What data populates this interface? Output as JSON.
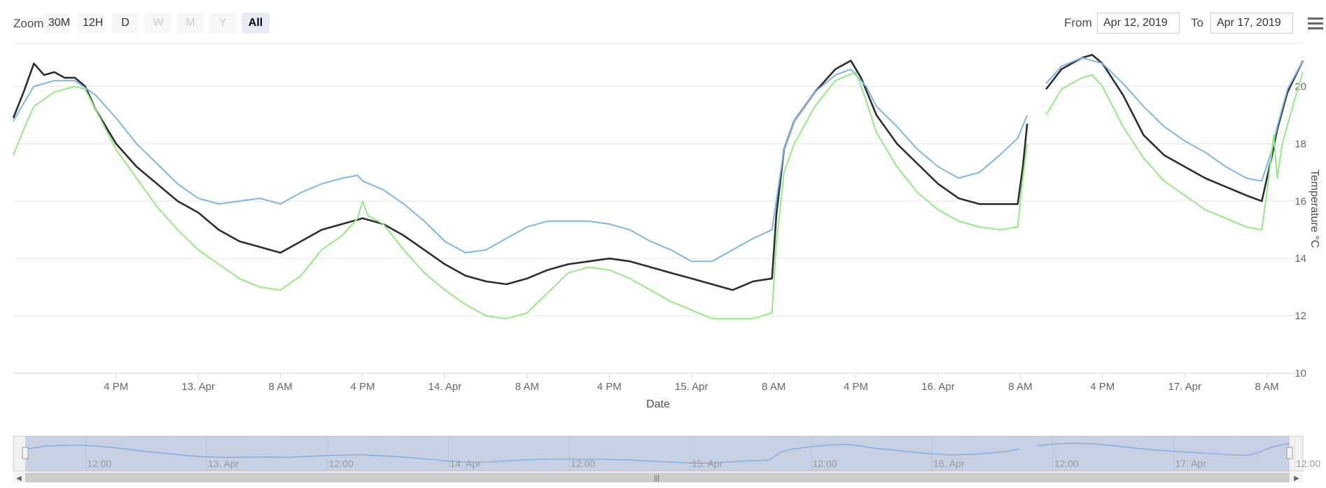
{
  "toolbar": {
    "zoom_label": "Zoom",
    "buttons": [
      "30M",
      "12H",
      "D",
      "W",
      "M",
      "Y",
      "All"
    ],
    "disabled_buttons": [
      "W",
      "M",
      "Y"
    ],
    "active_button": "All",
    "from_label": "From",
    "from_value": "Apr 12, 2019",
    "to_label": "To",
    "to_value": "Apr 17, 2019"
  },
  "colors": {
    "series_dark": "#2b2d33",
    "series_blue": "#7cb5ec",
    "series_green": "#90ed7d",
    "grid": "#e6e6e6",
    "navigator_mask": "rgba(102,133,194,0.3)"
  },
  "chart_data": {
    "type": "line",
    "xlabel": "Date",
    "ylabel": "Temperature °C",
    "x_range": [
      "2019-04-12T06:00",
      "2019-04-17T11:30"
    ],
    "ylim": [
      10,
      21.5
    ],
    "yticks": [
      10,
      12,
      14,
      16,
      18,
      20
    ],
    "xtick_labels": [
      "4 PM",
      "13. Apr",
      "8 AM",
      "4 PM",
      "14. Apr",
      "8 AM",
      "4 PM",
      "15. Apr",
      "8 AM",
      "4 PM",
      "16. Apr",
      "8 AM",
      "4 PM",
      "17. Apr",
      "8 AM"
    ],
    "xtick_times": [
      "2019-04-12T16:00",
      "2019-04-13T00:00",
      "2019-04-13T08:00",
      "2019-04-13T16:00",
      "2019-04-14T00:00",
      "2019-04-14T08:00",
      "2019-04-14T16:00",
      "2019-04-15T00:00",
      "2019-04-15T08:00",
      "2019-04-15T16:00",
      "2019-04-16T00:00",
      "2019-04-16T08:00",
      "2019-04-16T16:00",
      "2019-04-17T00:00",
      "2019-04-17T08:00"
    ],
    "navigator_labels": [
      "12:00",
      "13. Apr",
      "12:00",
      "14. Apr",
      "12:00",
      "15. Apr",
      "12:00",
      "16. Apr",
      "12:00",
      "17. Apr",
      "12:00"
    ],
    "navigator_times": [
      "2019-04-12T12:00",
      "2019-04-13T00:00",
      "2019-04-13T12:00",
      "2019-04-14T00:00",
      "2019-04-14T12:00",
      "2019-04-15T00:00",
      "2019-04-15T12:00",
      "2019-04-16T00:00",
      "2019-04-16T12:00",
      "2019-04-17T00:00",
      "2019-04-17T12:00"
    ],
    "grid": true,
    "series": [
      {
        "color": "#2b2d33",
        "points": [
          [
            "2019-04-12T06:00",
            18.9
          ],
          [
            "2019-04-12T07:00",
            19.8
          ],
          [
            "2019-04-12T08:00",
            20.8
          ],
          [
            "2019-04-12T09:00",
            20.4
          ],
          [
            "2019-04-12T10:00",
            20.5
          ],
          [
            "2019-04-12T11:00",
            20.3
          ],
          [
            "2019-04-12T12:00",
            20.3
          ],
          [
            "2019-04-12T13:00",
            20.0
          ],
          [
            "2019-04-12T14:00",
            19.2
          ],
          [
            "2019-04-12T16:00",
            18.0
          ],
          [
            "2019-04-12T18:00",
            17.2
          ],
          [
            "2019-04-12T20:00",
            16.6
          ],
          [
            "2019-04-12T22:00",
            16.0
          ],
          [
            "2019-04-13T00:00",
            15.6
          ],
          [
            "2019-04-13T02:00",
            15.0
          ],
          [
            "2019-04-13T04:00",
            14.6
          ],
          [
            "2019-04-13T06:00",
            14.4
          ],
          [
            "2019-04-13T08:00",
            14.2
          ],
          [
            "2019-04-13T10:00",
            14.6
          ],
          [
            "2019-04-13T12:00",
            15.0
          ],
          [
            "2019-04-13T14:00",
            15.2
          ],
          [
            "2019-04-13T16:00",
            15.4
          ],
          [
            "2019-04-13T18:00",
            15.2
          ],
          [
            "2019-04-13T20:00",
            14.8
          ],
          [
            "2019-04-13T22:00",
            14.3
          ],
          [
            "2019-04-14T00:00",
            13.8
          ],
          [
            "2019-04-14T02:00",
            13.4
          ],
          [
            "2019-04-14T04:00",
            13.2
          ],
          [
            "2019-04-14T06:00",
            13.1
          ],
          [
            "2019-04-14T08:00",
            13.3
          ],
          [
            "2019-04-14T10:00",
            13.6
          ],
          [
            "2019-04-14T12:00",
            13.8
          ],
          [
            "2019-04-14T14:00",
            13.9
          ],
          [
            "2019-04-14T16:00",
            14.0
          ],
          [
            "2019-04-14T18:00",
            13.9
          ],
          [
            "2019-04-14T20:00",
            13.7
          ],
          [
            "2019-04-14T22:00",
            13.5
          ],
          [
            "2019-04-15T00:00",
            13.3
          ],
          [
            "2019-04-15T02:00",
            13.1
          ],
          [
            "2019-04-15T04:00",
            12.9
          ],
          [
            "2019-04-15T06:00",
            13.2
          ],
          [
            "2019-04-15T07:50",
            13.3
          ],
          [
            "2019-04-15T08:15",
            15.5
          ],
          [
            "2019-04-15T09:00",
            17.8
          ],
          [
            "2019-04-15T10:00",
            18.8
          ],
          [
            "2019-04-15T12:00",
            19.8
          ],
          [
            "2019-04-15T14:00",
            20.6
          ],
          [
            "2019-04-15T15:30",
            20.9
          ],
          [
            "2019-04-15T16:30",
            20.3
          ],
          [
            "2019-04-15T18:00",
            19.0
          ],
          [
            "2019-04-15T20:00",
            18.0
          ],
          [
            "2019-04-15T22:00",
            17.3
          ],
          [
            "2019-04-16T00:00",
            16.6
          ],
          [
            "2019-04-16T02:00",
            16.1
          ],
          [
            "2019-04-16T04:00",
            15.9
          ],
          [
            "2019-04-16T06:00",
            15.9
          ],
          [
            "2019-04-16T07:45",
            15.9
          ],
          [
            "2019-04-16T08:15",
            17.2
          ],
          [
            "2019-04-16T08:40",
            18.7
          ],
          [
            "2019-04-16T09:30",
            null
          ],
          [
            "2019-04-16T10:30",
            19.9
          ],
          [
            "2019-04-16T12:00",
            20.6
          ],
          [
            "2019-04-16T14:00",
            21.0
          ],
          [
            "2019-04-16T15:00",
            21.1
          ],
          [
            "2019-04-16T16:00",
            20.8
          ],
          [
            "2019-04-16T18:00",
            19.7
          ],
          [
            "2019-04-16T20:00",
            18.3
          ],
          [
            "2019-04-16T22:00",
            17.6
          ],
          [
            "2019-04-17T00:00",
            17.2
          ],
          [
            "2019-04-17T02:00",
            16.8
          ],
          [
            "2019-04-17T04:00",
            16.5
          ],
          [
            "2019-04-17T06:00",
            16.2
          ],
          [
            "2019-04-17T07:30",
            16.0
          ],
          [
            "2019-04-17T08:30",
            17.6
          ],
          [
            "2019-04-17T09:00",
            18.5
          ],
          [
            "2019-04-17T10:00",
            19.8
          ],
          [
            "2019-04-17T11:30",
            20.9
          ]
        ]
      },
      {
        "color": "#7cb5ec",
        "points": [
          [
            "2019-04-12T06:00",
            18.8
          ],
          [
            "2019-04-12T08:00",
            20.0
          ],
          [
            "2019-04-12T10:00",
            20.2
          ],
          [
            "2019-04-12T12:00",
            20.2
          ],
          [
            "2019-04-12T14:00",
            19.7
          ],
          [
            "2019-04-12T16:00",
            18.9
          ],
          [
            "2019-04-12T18:00",
            18.0
          ],
          [
            "2019-04-12T20:00",
            17.3
          ],
          [
            "2019-04-12T22:00",
            16.6
          ],
          [
            "2019-04-13T00:00",
            16.1
          ],
          [
            "2019-04-13T02:00",
            15.9
          ],
          [
            "2019-04-13T04:00",
            16.0
          ],
          [
            "2019-04-13T06:00",
            16.1
          ],
          [
            "2019-04-13T08:00",
            15.9
          ],
          [
            "2019-04-13T10:00",
            16.3
          ],
          [
            "2019-04-13T12:00",
            16.6
          ],
          [
            "2019-04-13T14:00",
            16.8
          ],
          [
            "2019-04-13T15:30",
            16.9
          ],
          [
            "2019-04-13T16:00",
            16.7
          ],
          [
            "2019-04-13T18:00",
            16.4
          ],
          [
            "2019-04-13T20:00",
            15.9
          ],
          [
            "2019-04-13T22:00",
            15.3
          ],
          [
            "2019-04-14T00:00",
            14.6
          ],
          [
            "2019-04-14T02:00",
            14.2
          ],
          [
            "2019-04-14T04:00",
            14.3
          ],
          [
            "2019-04-14T06:00",
            14.7
          ],
          [
            "2019-04-14T08:00",
            15.1
          ],
          [
            "2019-04-14T10:00",
            15.3
          ],
          [
            "2019-04-14T12:00",
            15.3
          ],
          [
            "2019-04-14T14:00",
            15.3
          ],
          [
            "2019-04-14T16:00",
            15.2
          ],
          [
            "2019-04-14T18:00",
            15.0
          ],
          [
            "2019-04-14T20:00",
            14.6
          ],
          [
            "2019-04-14T22:00",
            14.3
          ],
          [
            "2019-04-15T00:00",
            13.9
          ],
          [
            "2019-04-15T02:00",
            13.9
          ],
          [
            "2019-04-15T04:00",
            14.3
          ],
          [
            "2019-04-15T06:00",
            14.7
          ],
          [
            "2019-04-15T07:50",
            15.0
          ],
          [
            "2019-04-15T08:15",
            16.0
          ],
          [
            "2019-04-15T09:00",
            17.8
          ],
          [
            "2019-04-15T10:00",
            18.8
          ],
          [
            "2019-04-15T12:00",
            19.8
          ],
          [
            "2019-04-15T14:00",
            20.4
          ],
          [
            "2019-04-15T15:30",
            20.6
          ],
          [
            "2019-04-15T17:00",
            20.0
          ],
          [
            "2019-04-15T18:00",
            19.3
          ],
          [
            "2019-04-15T20:00",
            18.6
          ],
          [
            "2019-04-15T22:00",
            17.8
          ],
          [
            "2019-04-16T00:00",
            17.2
          ],
          [
            "2019-04-16T02:00",
            16.8
          ],
          [
            "2019-04-16T04:00",
            17.0
          ],
          [
            "2019-04-16T06:00",
            17.6
          ],
          [
            "2019-04-16T07:45",
            18.2
          ],
          [
            "2019-04-16T08:40",
            19.0
          ],
          [
            "2019-04-16T09:30",
            null
          ],
          [
            "2019-04-16T10:30",
            20.1
          ],
          [
            "2019-04-16T12:00",
            20.7
          ],
          [
            "2019-04-16T14:00",
            21.0
          ],
          [
            "2019-04-16T16:00",
            20.8
          ],
          [
            "2019-04-16T18:00",
            20.1
          ],
          [
            "2019-04-16T20:00",
            19.3
          ],
          [
            "2019-04-16T22:00",
            18.6
          ],
          [
            "2019-04-17T00:00",
            18.1
          ],
          [
            "2019-04-17T02:00",
            17.7
          ],
          [
            "2019-04-17T04:00",
            17.2
          ],
          [
            "2019-04-17T06:00",
            16.8
          ],
          [
            "2019-04-17T07:30",
            16.7
          ],
          [
            "2019-04-17T08:30",
            17.8
          ],
          [
            "2019-04-17T09:00",
            18.6
          ],
          [
            "2019-04-17T10:00",
            19.9
          ],
          [
            "2019-04-17T11:30",
            20.9
          ]
        ]
      },
      {
        "color": "#90ed7d",
        "points": [
          [
            "2019-04-12T06:00",
            17.6
          ],
          [
            "2019-04-12T07:00",
            18.5
          ],
          [
            "2019-04-12T08:00",
            19.3
          ],
          [
            "2019-04-12T10:00",
            19.8
          ],
          [
            "2019-04-12T12:00",
            20.0
          ],
          [
            "2019-04-12T13:00",
            19.9
          ],
          [
            "2019-04-12T14:00",
            19.2
          ],
          [
            "2019-04-12T16:00",
            17.8
          ],
          [
            "2019-04-12T18:00",
            16.8
          ],
          [
            "2019-04-12T20:00",
            15.8
          ],
          [
            "2019-04-12T22:00",
            15.0
          ],
          [
            "2019-04-13T00:00",
            14.3
          ],
          [
            "2019-04-13T02:00",
            13.8
          ],
          [
            "2019-04-13T04:00",
            13.3
          ],
          [
            "2019-04-13T06:00",
            13.0
          ],
          [
            "2019-04-13T08:00",
            12.9
          ],
          [
            "2019-04-13T10:00",
            13.4
          ],
          [
            "2019-04-13T12:00",
            14.3
          ],
          [
            "2019-04-13T14:00",
            14.8
          ],
          [
            "2019-04-13T15:30",
            15.4
          ],
          [
            "2019-04-13T16:00",
            16.0
          ],
          [
            "2019-04-13T16:30",
            15.5
          ],
          [
            "2019-04-13T18:00",
            15.2
          ],
          [
            "2019-04-13T20:00",
            14.3
          ],
          [
            "2019-04-13T22:00",
            13.5
          ],
          [
            "2019-04-14T00:00",
            12.9
          ],
          [
            "2019-04-14T02:00",
            12.4
          ],
          [
            "2019-04-14T04:00",
            12.0
          ],
          [
            "2019-04-14T06:00",
            11.9
          ],
          [
            "2019-04-14T08:00",
            12.1
          ],
          [
            "2019-04-14T10:00",
            12.8
          ],
          [
            "2019-04-14T12:00",
            13.5
          ],
          [
            "2019-04-14T14:00",
            13.7
          ],
          [
            "2019-04-14T16:00",
            13.6
          ],
          [
            "2019-04-14T18:00",
            13.3
          ],
          [
            "2019-04-14T20:00",
            12.9
          ],
          [
            "2019-04-14T22:00",
            12.5
          ],
          [
            "2019-04-15T00:00",
            12.2
          ],
          [
            "2019-04-15T02:00",
            11.9
          ],
          [
            "2019-04-15T04:00",
            11.9
          ],
          [
            "2019-04-15T06:00",
            11.9
          ],
          [
            "2019-04-15T07:50",
            12.1
          ],
          [
            "2019-04-15T08:15",
            14.5
          ],
          [
            "2019-04-15T09:00",
            17.0
          ],
          [
            "2019-04-15T10:00",
            18.0
          ],
          [
            "2019-04-15T12:00",
            19.3
          ],
          [
            "2019-04-15T14:00",
            20.2
          ],
          [
            "2019-04-15T16:00",
            20.5
          ],
          [
            "2019-04-15T17:00",
            19.5
          ],
          [
            "2019-04-15T18:00",
            18.4
          ],
          [
            "2019-04-15T20:00",
            17.2
          ],
          [
            "2019-04-15T22:00",
            16.3
          ],
          [
            "2019-04-16T00:00",
            15.7
          ],
          [
            "2019-04-16T02:00",
            15.3
          ],
          [
            "2019-04-16T04:00",
            15.1
          ],
          [
            "2019-04-16T06:00",
            15.0
          ],
          [
            "2019-04-16T07:45",
            15.1
          ],
          [
            "2019-04-16T08:15",
            16.8
          ],
          [
            "2019-04-16T08:40",
            18.0
          ],
          [
            "2019-04-16T09:30",
            null
          ],
          [
            "2019-04-16T10:30",
            19.0
          ],
          [
            "2019-04-16T12:00",
            19.9
          ],
          [
            "2019-04-16T14:00",
            20.3
          ],
          [
            "2019-04-16T15:00",
            20.4
          ],
          [
            "2019-04-16T16:00",
            20.0
          ],
          [
            "2019-04-16T18:00",
            18.6
          ],
          [
            "2019-04-16T20:00",
            17.5
          ],
          [
            "2019-04-16T22:00",
            16.7
          ],
          [
            "2019-04-17T00:00",
            16.2
          ],
          [
            "2019-04-17T02:00",
            15.7
          ],
          [
            "2019-04-17T04:00",
            15.4
          ],
          [
            "2019-04-17T06:00",
            15.1
          ],
          [
            "2019-04-17T07:30",
            15.0
          ],
          [
            "2019-04-17T08:00",
            16.3
          ],
          [
            "2019-04-17T08:40",
            18.3
          ],
          [
            "2019-04-17T09:00",
            16.8
          ],
          [
            "2019-04-17T09:30",
            18.0
          ],
          [
            "2019-04-17T10:30",
            19.3
          ],
          [
            "2019-04-17T11:30",
            20.5
          ]
        ]
      }
    ]
  }
}
